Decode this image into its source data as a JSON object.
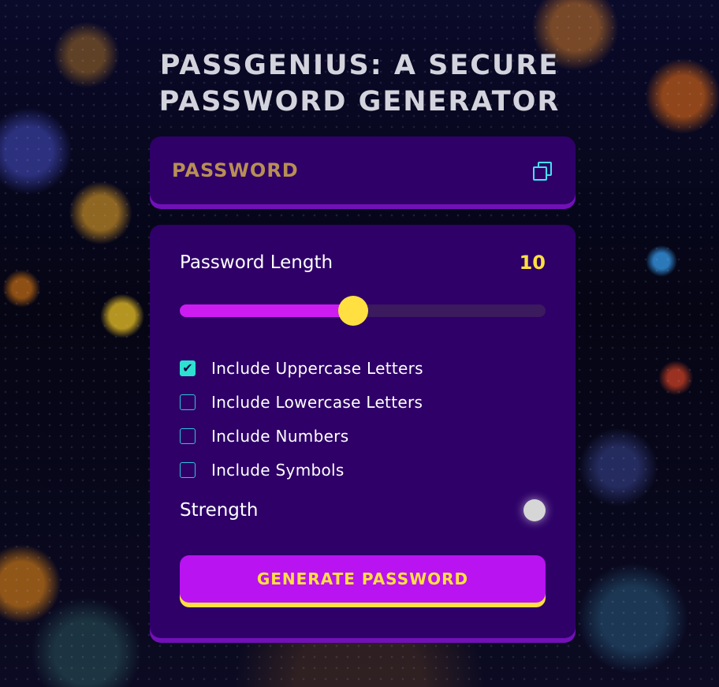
{
  "header": {
    "title_line1": "PASSGENIUS: A SECURE",
    "title_line2": "PASSWORD GENERATOR"
  },
  "password_display": {
    "text": "PASSWORD",
    "copy_icon": "copy-icon"
  },
  "length": {
    "label": "Password Length",
    "value": "10",
    "slider_fraction": 0.475
  },
  "options": [
    {
      "label": "Include Uppercase Letters",
      "checked": true
    },
    {
      "label": "Include Lowercase Letters",
      "checked": false
    },
    {
      "label": "Include Numbers",
      "checked": false
    },
    {
      "label": "Include Symbols",
      "checked": false
    }
  ],
  "strength": {
    "label": "Strength"
  },
  "generate_button": {
    "label": "GENERATE PASSWORD"
  },
  "colors": {
    "card_bg": "#2e0068",
    "accent_yellow": "#ffe040",
    "accent_purple": "#b813f0",
    "checkbox_cyan": "#2ee0d2"
  }
}
